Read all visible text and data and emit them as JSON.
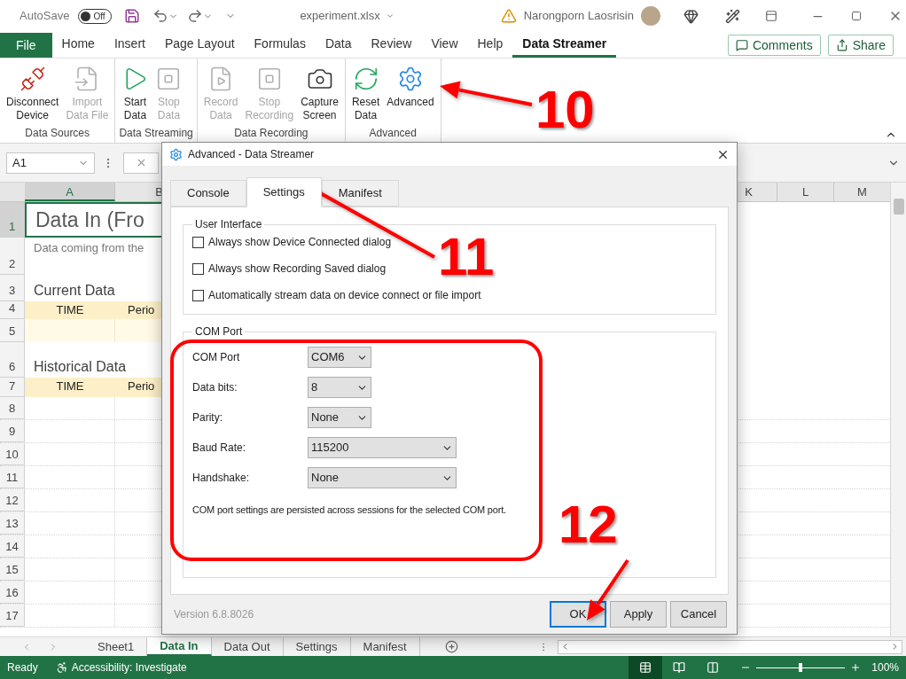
{
  "title_bar": {
    "autosave": {
      "label": "AutoSave",
      "on": false,
      "state_text": "Off"
    },
    "file_name": "experiment.xlsx",
    "user_name": "Narongporn Laosrisin"
  },
  "menu_tabs": [
    {
      "label": "File",
      "kind": "file",
      "selected": false
    },
    {
      "label": "Home",
      "kind": "tab",
      "selected": false
    },
    {
      "label": "Insert",
      "kind": "tab",
      "selected": false
    },
    {
      "label": "Page Layout",
      "kind": "tab",
      "selected": false
    },
    {
      "label": "Formulas",
      "kind": "tab",
      "selected": false
    },
    {
      "label": "Data",
      "kind": "tab",
      "selected": false
    },
    {
      "label": "Review",
      "kind": "tab",
      "selected": false
    },
    {
      "label": "View",
      "kind": "tab",
      "selected": false
    },
    {
      "label": "Help",
      "kind": "tab",
      "selected": false
    },
    {
      "label": "Data Streamer",
      "kind": "tab",
      "selected": true
    }
  ],
  "header_buttons": [
    {
      "label": "Comments"
    },
    {
      "label": "Share"
    }
  ],
  "ribbon_groups": [
    {
      "label": "Data Sources",
      "buttons": [
        {
          "lines": [
            "Disconnect",
            "Device"
          ],
          "disabled": false
        },
        {
          "lines": [
            "Import",
            "Data File"
          ],
          "disabled": true
        }
      ]
    },
    {
      "label": "Data Streaming",
      "buttons": [
        {
          "lines": [
            "Start",
            "Data"
          ],
          "disabled": false
        },
        {
          "lines": [
            "Stop",
            "Data"
          ],
          "disabled": true
        }
      ]
    },
    {
      "label": "Data Recording",
      "buttons": [
        {
          "lines": [
            "Record",
            "Data"
          ],
          "disabled": true
        },
        {
          "lines": [
            "Stop",
            "Recording"
          ],
          "disabled": true
        },
        {
          "lines": [
            "Capture",
            "Screen"
          ],
          "disabled": false
        }
      ]
    },
    {
      "label": "Advanced",
      "buttons": [
        {
          "lines": [
            "Reset",
            "Data"
          ],
          "disabled": false
        },
        {
          "lines": [
            "Advanced"
          ],
          "disabled": false
        }
      ]
    }
  ],
  "formula_bar": {
    "name_box": "A1"
  },
  "sheet": {
    "columns_left": [
      {
        "label": "A",
        "selected": true
      },
      {
        "label": "B",
        "selected": false
      }
    ],
    "columns_right": [
      {
        "label": "K",
        "selected": false
      },
      {
        "label": "L",
        "selected": false
      },
      {
        "label": "M",
        "selected": false
      }
    ],
    "rows": [
      {
        "number": "1",
        "selected": true,
        "kind": "title",
        "cells": [
          "Data In (Fro"
        ]
      },
      {
        "number": "2",
        "selected": false,
        "kind": "subtitle",
        "cells": [
          "Data coming from the"
        ]
      },
      {
        "number": "3",
        "selected": false,
        "kind": "section",
        "cells": [
          "Current Data"
        ]
      },
      {
        "number": "4",
        "selected": false,
        "kind": "header",
        "cells": [
          "TIME",
          "Perio"
        ]
      },
      {
        "number": "5",
        "selected": false,
        "kind": "data"
      },
      {
        "number": "6",
        "selected": false,
        "kind": "section",
        "cells": [
          "Historical Data"
        ]
      },
      {
        "number": "7",
        "selected": false,
        "kind": "header",
        "cells": [
          "TIME",
          "Perio"
        ]
      },
      {
        "number": "8",
        "selected": false,
        "kind": "empty"
      },
      {
        "number": "9",
        "selected": false,
        "kind": "empty"
      },
      {
        "number": "10",
        "selected": false,
        "kind": "empty"
      },
      {
        "number": "11",
        "selected": false,
        "kind": "empty"
      },
      {
        "number": "12",
        "selected": false,
        "kind": "empty"
      },
      {
        "number": "13",
        "selected": false,
        "kind": "empty"
      },
      {
        "number": "14",
        "selected": false,
        "kind": "empty"
      },
      {
        "number": "15",
        "selected": false,
        "kind": "empty"
      },
      {
        "number": "16",
        "selected": false,
        "kind": "empty"
      },
      {
        "number": "17",
        "selected": false,
        "kind": "empty"
      }
    ]
  },
  "sheet_tabs": [
    {
      "label": "Sheet1",
      "selected": false
    },
    {
      "label": "Data In",
      "selected": true
    },
    {
      "label": "Data Out",
      "selected": false
    },
    {
      "label": "Settings",
      "selected": false
    },
    {
      "label": "Manifest",
      "selected": false
    }
  ],
  "status_bar": {
    "status": "Ready",
    "accessibility": "Accessibility: Investigate",
    "views": [
      {
        "selected": true
      },
      {
        "selected": false
      },
      {
        "selected": false
      }
    ],
    "zoom": {
      "level": 0.5,
      "reading": "100%"
    }
  },
  "dialog": {
    "title": "Advanced - Data Streamer",
    "tabs": [
      {
        "label": "Console",
        "selected": false
      },
      {
        "label": "Settings",
        "selected": true
      },
      {
        "label": "Manifest",
        "selected": false
      }
    ],
    "user_interface": {
      "title": "User Interface",
      "options": [
        {
          "label": "Always show Device Connected dialog",
          "checked": false
        },
        {
          "label": "Always show Recording Saved dialog",
          "checked": false
        },
        {
          "label": "Automatically stream data on device connect or file import",
          "checked": false
        }
      ]
    },
    "com_port": {
      "title": "COM Port",
      "fields": [
        {
          "label": "COM Port",
          "value": "COM6"
        },
        {
          "label": "Data bits:",
          "value": "8"
        },
        {
          "label": "Parity:",
          "value": "None"
        },
        {
          "label": "Baud Rate:",
          "value": "115200"
        },
        {
          "label": "Handshake:",
          "value": "None"
        }
      ],
      "note": "COM port settings are persisted across sessions for the selected COM port."
    },
    "version": "Version 6.8.8026",
    "buttons": [
      {
        "label": "OK",
        "default": true
      },
      {
        "label": "Apply",
        "default": false
      },
      {
        "label": "Cancel",
        "default": false
      }
    ]
  },
  "annotations": [
    {
      "label": "10"
    },
    {
      "label": "11"
    },
    {
      "label": "12"
    }
  ]
}
